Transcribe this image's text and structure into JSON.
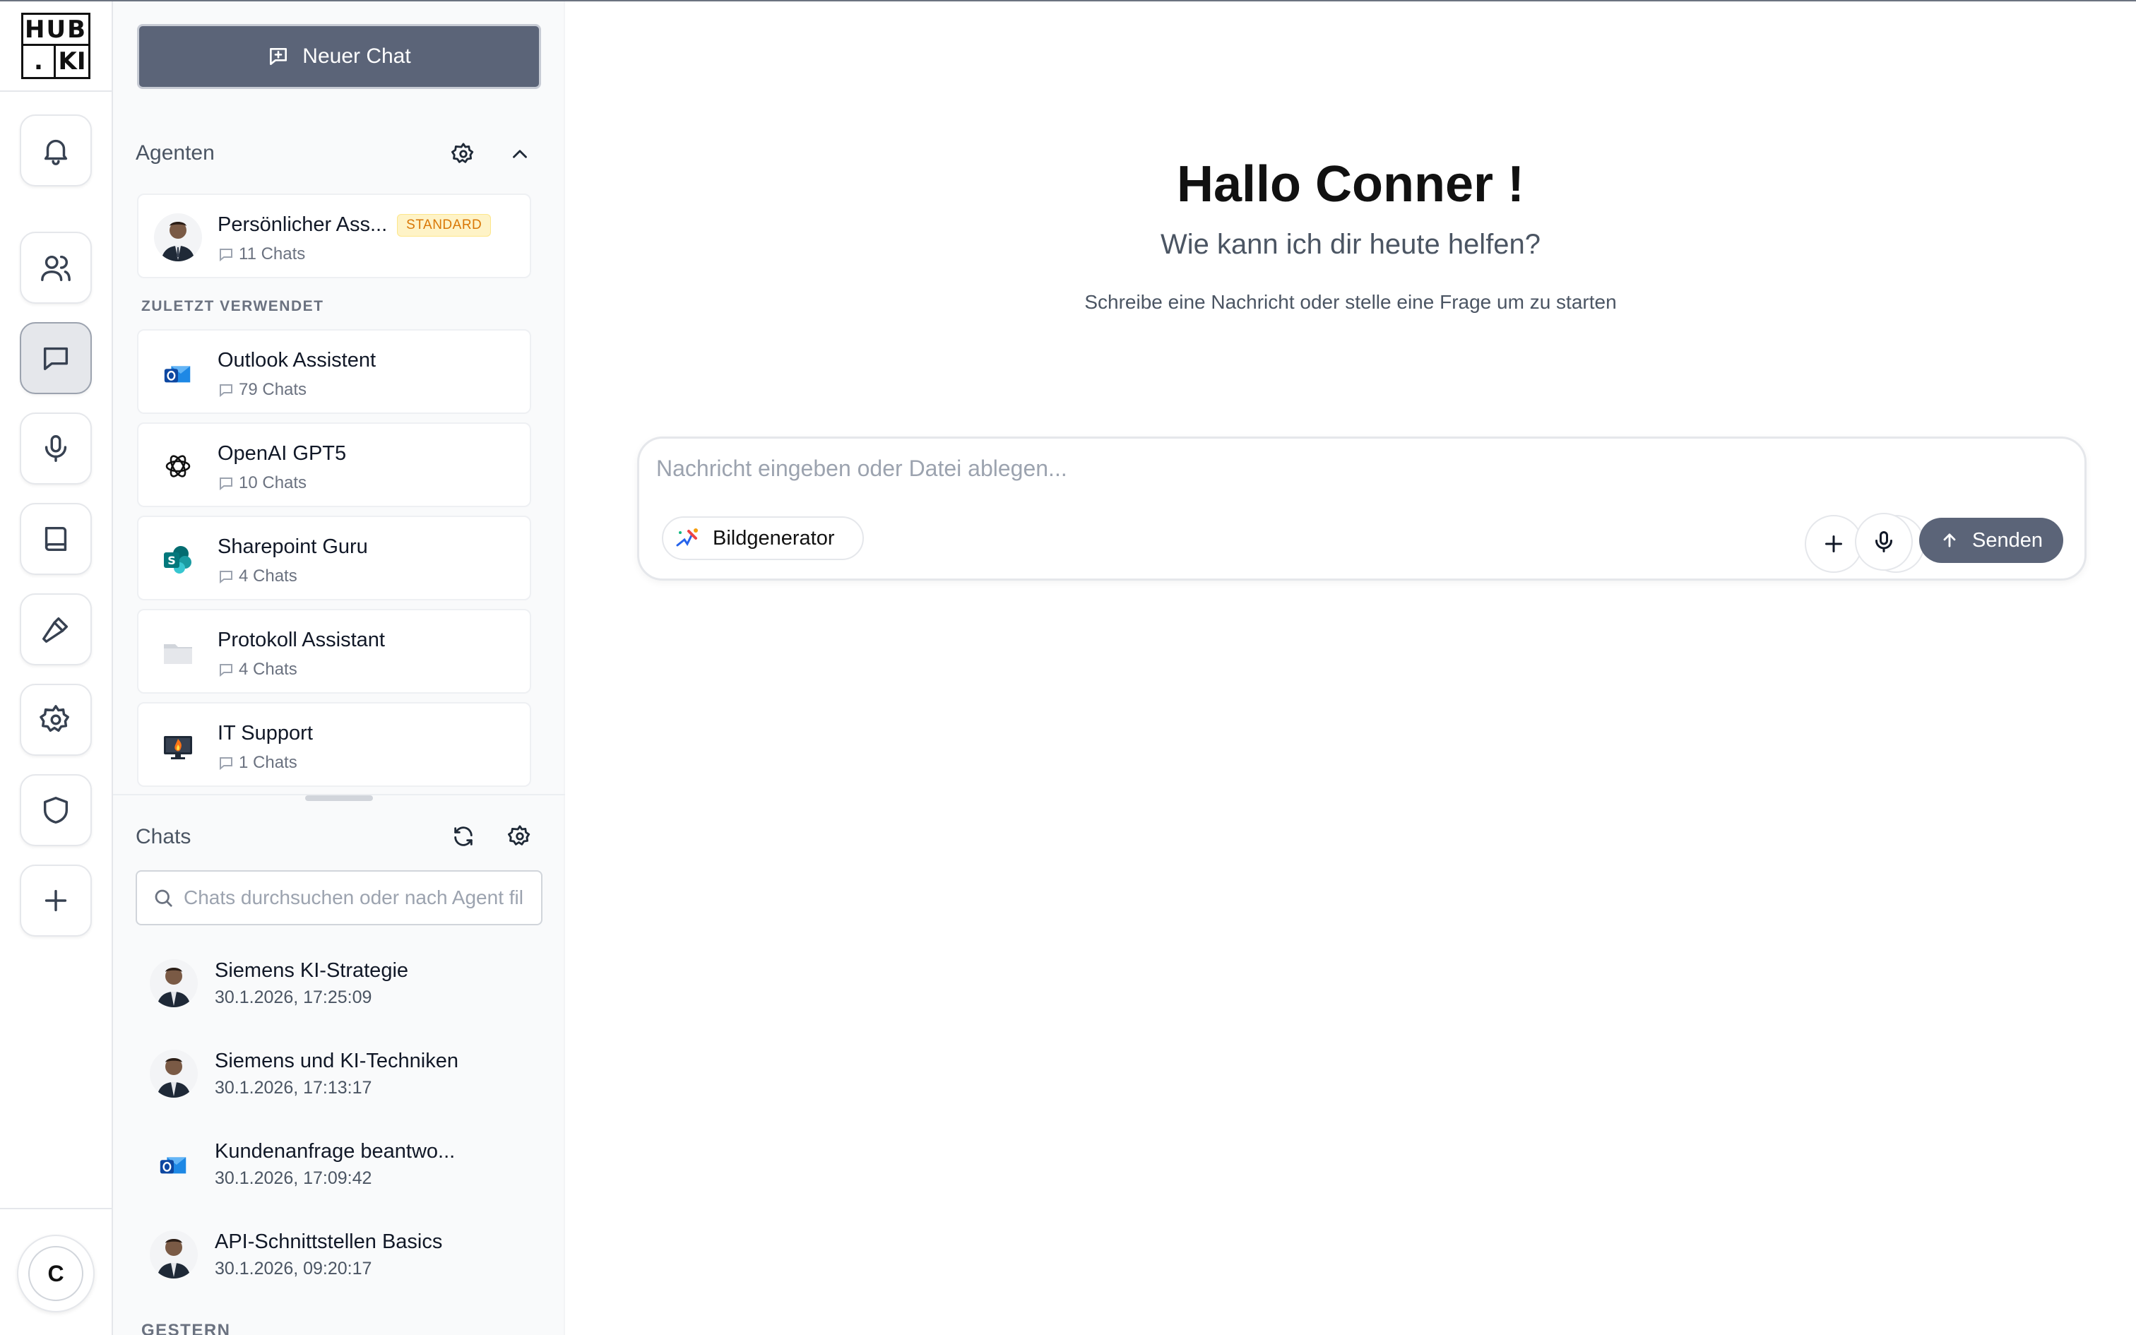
{
  "logo": {
    "row1": "HUB",
    "row2a": ".",
    "row2b": "KI"
  },
  "rail": {
    "items": [
      {
        "name": "bell-icon"
      },
      {
        "name": "users-icon"
      },
      {
        "name": "chat-icon",
        "active": true
      },
      {
        "name": "microphone-icon"
      },
      {
        "name": "book-icon"
      },
      {
        "name": "hammer-icon"
      },
      {
        "name": "gear-icon"
      },
      {
        "name": "shield-icon"
      },
      {
        "name": "plus-icon"
      }
    ],
    "user_initial": "C"
  },
  "sidebar": {
    "new_chat_label": "Neuer Chat",
    "agents_title": "Agenten",
    "default_agent": {
      "name": "Persönlicher Ass...",
      "badge": "STANDARD",
      "chats": "11 Chats"
    },
    "recent_label": "ZULETZT VERWENDET",
    "recent_agents": [
      {
        "name": "Outlook Assistent",
        "chats": "79 Chats",
        "icon": "outlook-icon"
      },
      {
        "name": "OpenAI GPT5",
        "chats": "10 Chats",
        "icon": "openai-icon"
      },
      {
        "name": "Sharepoint Guru",
        "chats": "4 Chats",
        "icon": "sharepoint-icon"
      },
      {
        "name": "Protokoll Assistant",
        "chats": "4 Chats",
        "icon": "folder-icon"
      },
      {
        "name": "IT Support",
        "chats": "1 Chats",
        "icon": "monitor-fire-icon"
      }
    ],
    "chats_title": "Chats",
    "search_placeholder": "Chats durchsuchen oder nach Agent filtern",
    "chats": [
      {
        "title": "Siemens KI-Strategie",
        "time": "30.1.2026, 17:25:09",
        "icon": "person-avatar"
      },
      {
        "title": "Siemens und KI-Techniken",
        "time": "30.1.2026, 17:13:17",
        "icon": "person-avatar"
      },
      {
        "title": "Kundenanfrage beantwo...",
        "time": "30.1.2026, 17:09:42",
        "icon": "outlook-icon"
      },
      {
        "title": "API-Schnittstellen Basics",
        "time": "30.1.2026, 09:20:17",
        "icon": "person-avatar"
      }
    ],
    "older_group_label": "GESTERN"
  },
  "main": {
    "greeting": "Hallo Conner !",
    "subtitle": "Wie kann ich dir heute helfen?",
    "hint": "Schreibe eine Nachricht oder stelle eine Frage um zu starten",
    "composer_placeholder": "Nachricht eingeben oder Datei ablegen...",
    "tool_chip_label": "Bildgenerator",
    "send_label": "Senden"
  },
  "colors": {
    "primary_button": "#5b6478",
    "badge_text": "#d97706",
    "badge_bg": "#fef3c7"
  }
}
